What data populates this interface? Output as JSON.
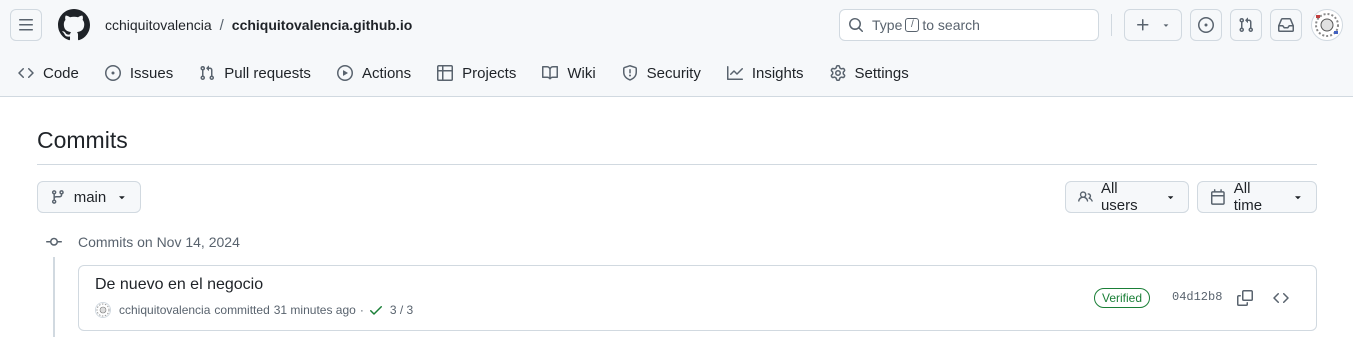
{
  "header": {
    "owner": "cchiquitovalencia",
    "separator": "/",
    "repo": "cchiquitovalencia.github.io",
    "search": {
      "prefix": "Type",
      "key": "/",
      "suffix": "to search"
    }
  },
  "nav": {
    "items": [
      {
        "label": "Code",
        "icon": "code-icon"
      },
      {
        "label": "Issues",
        "icon": "issue-opened-icon"
      },
      {
        "label": "Pull requests",
        "icon": "git-pull-request-icon"
      },
      {
        "label": "Actions",
        "icon": "play-icon"
      },
      {
        "label": "Projects",
        "icon": "table-icon"
      },
      {
        "label": "Wiki",
        "icon": "book-icon"
      },
      {
        "label": "Security",
        "icon": "shield-icon"
      },
      {
        "label": "Insights",
        "icon": "graph-icon"
      },
      {
        "label": "Settings",
        "icon": "gear-icon"
      }
    ]
  },
  "page": {
    "title": "Commits",
    "branch": "main",
    "users_filter": "All users",
    "time_filter": "All time"
  },
  "commit_groups": [
    {
      "date": "Commits on Nov 14, 2024",
      "commits": [
        {
          "message": "De nuevo en el negocio",
          "author": "cchiquitovalencia",
          "action": "committed",
          "time": "31 minutes ago",
          "dot": "·",
          "checks": "3 / 3",
          "verified": "Verified",
          "sha": "04d12b8"
        }
      ]
    }
  ],
  "colors": {
    "accent_green": "#1a7f37",
    "muted": "#59636e",
    "border": "#d1d9e0",
    "header_bg": "#f6f8fa"
  }
}
